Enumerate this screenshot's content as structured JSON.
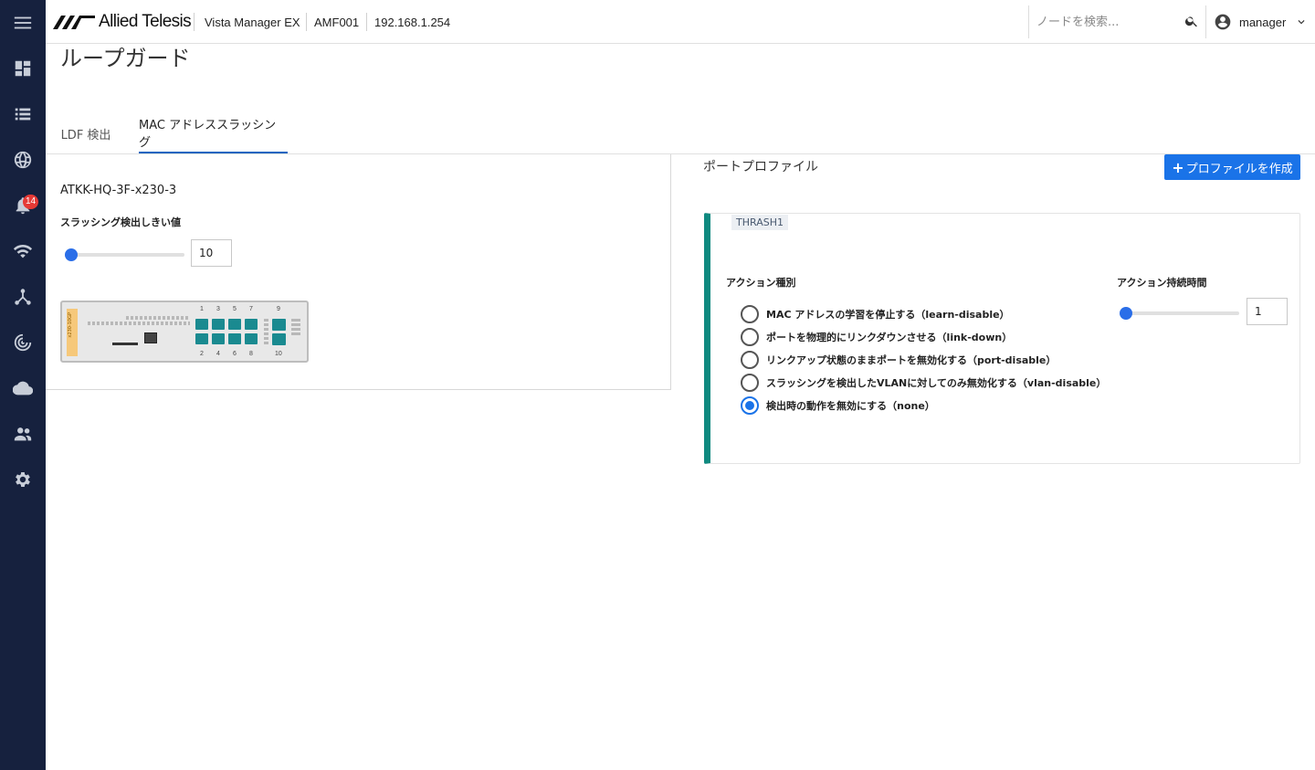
{
  "header": {
    "brand": "Allied Telesis",
    "product": "Vista Manager EX",
    "area": "AMF001",
    "ip": "192.168.1.254",
    "search_placeholder": "ノードを検索...",
    "user": "manager"
  },
  "sidebar": {
    "notification_count": "14",
    "icons": [
      "menu-icon",
      "dashboard-icon",
      "list-icon",
      "globe-icon",
      "bell-icon",
      "wifi-icon",
      "topology-icon",
      "radar-icon",
      "cloud-icon",
      "users-icon",
      "gear-icon"
    ]
  },
  "page": {
    "title": "ループガード",
    "tabs": [
      {
        "label": "LDF 検出",
        "active": false
      },
      {
        "label": "MAC アドレススラッシング",
        "active": true
      }
    ]
  },
  "left": {
    "node_name": "ATKK-HQ-3F-x230-3",
    "threshold_label": "スラッシング検出しきい値",
    "threshold_value": "10",
    "switch_model": "x230-10GP",
    "port_numbers_top": [
      "1",
      "3",
      "5",
      "7",
      "9"
    ],
    "port_numbers_bottom": [
      "2",
      "4",
      "6",
      "8",
      "10"
    ]
  },
  "right": {
    "title": "ポートプロファイル",
    "create_button": "プロファイルを作成",
    "profile": {
      "name": "THRASH1",
      "action_type_label": "アクション種別",
      "duration_label": "アクション持続時間",
      "duration_value": "1",
      "options": [
        {
          "label": "MAC アドレスの学習を停止する（learn-disable）",
          "checked": false
        },
        {
          "label": "ポートを物理的にリンクダウンさせる（link-down）",
          "checked": false
        },
        {
          "label": "リンクアップ状態のままポートを無効化する（port-disable）",
          "checked": false
        },
        {
          "label": "スラッシングを検出したVLANに対してのみ無効化する（vlan-disable）",
          "checked": false
        },
        {
          "label": "検出時の動作を無効にする（none）",
          "checked": true
        }
      ]
    }
  },
  "colors": {
    "sidebar_bg": "#16213e",
    "accent": "#1a73e8",
    "profile_bar": "#0f8a80",
    "port": "#1a8a90",
    "badge": "#e53935"
  }
}
